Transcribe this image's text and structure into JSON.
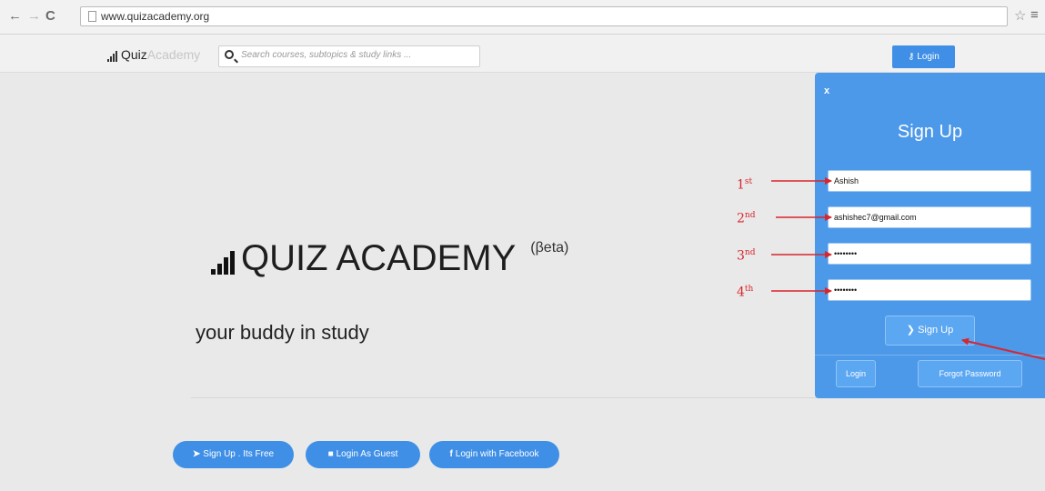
{
  "browser": {
    "url": "www.quizacademy.org",
    "icons": {
      "back": "arrow-left-icon",
      "forward": "arrow-right-icon",
      "reload": "reload-icon",
      "bookmark": "star-icon",
      "menu": "hamburger-menu-icon"
    }
  },
  "nav": {
    "brand": "Quiz",
    "brand_sub": "Academy",
    "search_placeholder": "Search courses, subtopics & study links ...",
    "login_label": "Login"
  },
  "hero": {
    "title": "QUIZ ACADEMY",
    "beta": "(βeta)",
    "tagline": "your buddy in study"
  },
  "actions": {
    "signup_label": "Sign Up . Its Free",
    "guest_label": "Login As Guest",
    "facebook_label": "Login with Facebook"
  },
  "signup_panel": {
    "close": "x",
    "title": "Sign Up",
    "name_value": "Ashish",
    "email_value": "ashishec7@gmail.com",
    "password_value": "••••••••",
    "confirm_value": "••••••••",
    "submit_label": "Sign Up",
    "login_label": "Login",
    "forgot_label": "Forgot Password"
  },
  "annotations": [
    {
      "num": "1",
      "suffix": "st"
    },
    {
      "num": "2",
      "suffix": "nd"
    },
    {
      "num": "3",
      "suffix": "nd"
    },
    {
      "num": "4",
      "suffix": "th"
    }
  ],
  "colors": {
    "primary": "#3f8fe6",
    "panel": "#4c98e9",
    "annotation": "#d8262c"
  }
}
